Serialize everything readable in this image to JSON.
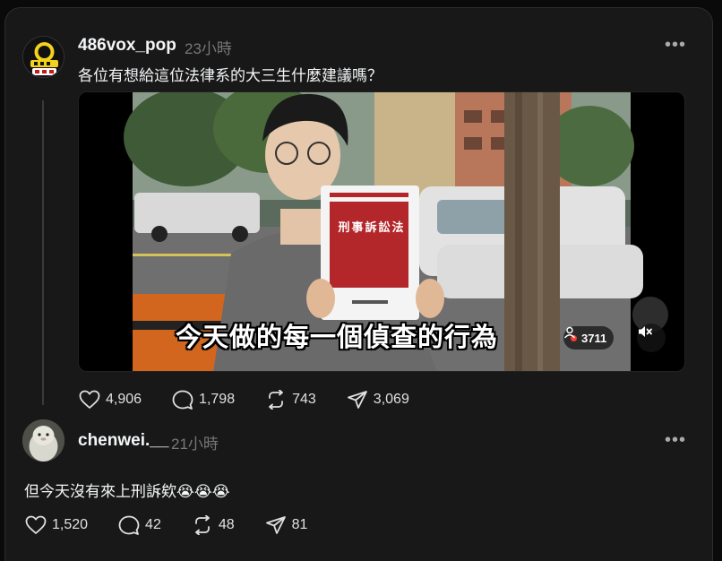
{
  "post": {
    "username": "486vox_pop",
    "time": "23小時",
    "text": "各位有想給這位法律系的大三生什麼建議嗎？",
    "avatar_text": "486街頭全民調",
    "video": {
      "subtitle": "今天做的每一個偵查的行為",
      "viewers": "3711",
      "book_title": "刑事訴訟法"
    },
    "actions": {
      "likes": "4,906",
      "comments": "1,798",
      "reposts": "743",
      "shares": "3,069"
    }
  },
  "reply": {
    "username": "chenwei.__",
    "time": "21小時",
    "text": "但今天沒有來上刑訴欸😭😭😭",
    "actions": {
      "likes": "1,520",
      "comments": "42",
      "reposts": "48",
      "shares": "81"
    }
  },
  "colors": {
    "background": "#0a0a0a",
    "panel": "#181818",
    "text": "#f3f5f7",
    "muted": "#777777",
    "live_red": "#ff3b30"
  },
  "icons": [
    "heart-icon",
    "comment-icon",
    "repost-icon",
    "share-icon",
    "more-icon",
    "mute-icon",
    "viewer-icon"
  ]
}
